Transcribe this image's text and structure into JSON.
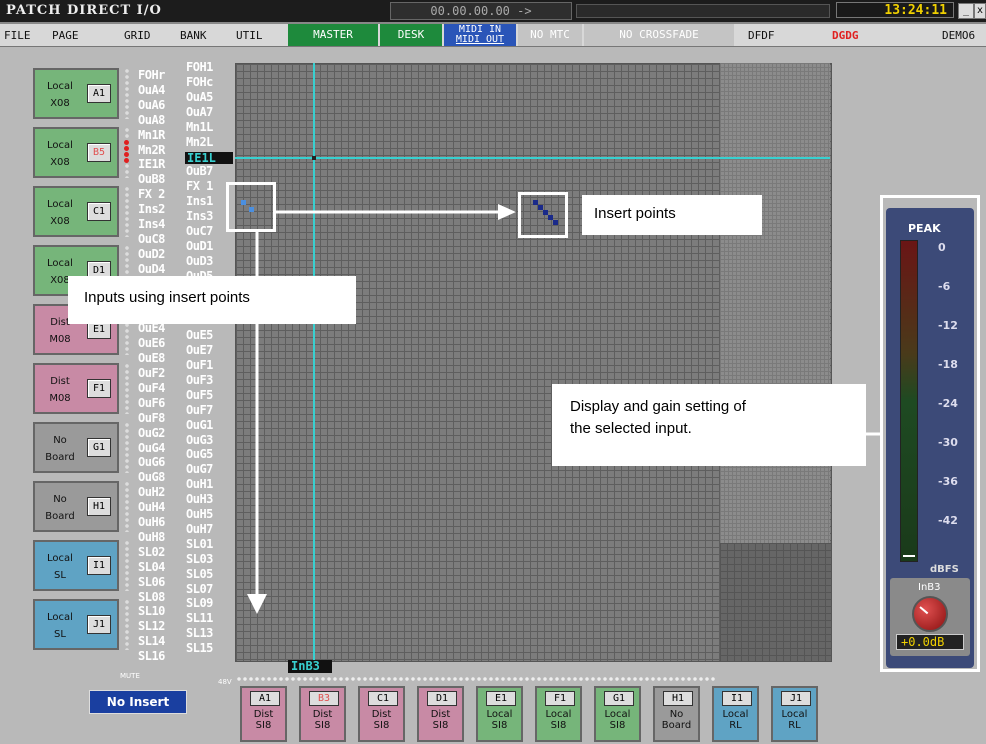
{
  "titlebar": {
    "title": "PATCH DIRECT I/O",
    "timecode": "00.00.00.00  ->",
    "clock": "13:24:11"
  },
  "menu": {
    "items": [
      "FILE",
      "PAGE",
      "GRID",
      "BANK",
      "UTIL"
    ],
    "master": "MASTER",
    "desk": "DESK",
    "midi_in": "MIDI IN",
    "midi_out": "MIDI OUT",
    "no_mtc": "NO MTC",
    "no_crossfade": "NO CROSSFADE",
    "dfdf": "DFDF",
    "dgdg": "DGDG",
    "demo": "DEMO6"
  },
  "left_boards": [
    {
      "line1": "Local",
      "line2": "X08",
      "id": "A1",
      "color": "#76b57a"
    },
    {
      "line1": "Local",
      "line2": "X08",
      "id": "B5",
      "color": "#76b57a",
      "id_color": "#e05050"
    },
    {
      "line1": "Local",
      "line2": "X08",
      "id": "C1",
      "color": "#76b57a"
    },
    {
      "line1": "Local",
      "line2": "X08",
      "id": "D1",
      "color": "#76b57a"
    },
    {
      "line1": "Dist",
      "line2": "M08",
      "id": "E1",
      "color": "#c88aa5"
    },
    {
      "line1": "Dist",
      "line2": "M08",
      "id": "F1",
      "color": "#c88aa5"
    },
    {
      "line1": "No",
      "line2": "Board",
      "id": "G1",
      "color": "#9a9a9a"
    },
    {
      "line1": "No",
      "line2": "Board",
      "id": "H1",
      "color": "#9a9a9a"
    },
    {
      "line1": "Local",
      "line2": "SL",
      "id": "I1",
      "color": "#5fa3c4"
    },
    {
      "line1": "Local",
      "line2": "SL",
      "id": "J1",
      "color": "#5fa3c4"
    }
  ],
  "col_left": [
    "FOHr",
    "OuA4",
    "OuA6",
    "OuA8",
    "Mn1R",
    "Mn2R",
    "IE1R",
    "OuB8",
    "FX 2",
    "Ins2",
    "Ins4",
    "OuC8",
    "OuD2",
    "OuD4",
    "",
    "",
    "",
    "OuE4",
    "OuE6",
    "OuE8",
    "OuF2",
    "OuF4",
    "OuF6",
    "OuF8",
    "OuG2",
    "OuG4",
    "OuG6",
    "OuG8",
    "OuH2",
    "OuH4",
    "OuH6",
    "OuH8",
    "SL02",
    "SL04",
    "SL06",
    "SL08",
    "SL10",
    "SL12",
    "SL14",
    "SL16"
  ],
  "col_right": [
    "FOH1",
    "FOHc",
    "OuA5",
    "OuA7",
    "Mn1L",
    "Mn2L",
    "IE1L",
    "OuB7",
    "FX 1",
    "Ins1",
    "Ins3",
    "OuC7",
    "OuD1",
    "OuD3",
    "OuD5",
    "",
    "",
    "OuE3",
    "OuE5",
    "OuE7",
    "OuF1",
    "OuF3",
    "OuF5",
    "OuF7",
    "OuG1",
    "OuG3",
    "OuG5",
    "OuG7",
    "OuH1",
    "OuH3",
    "OuH5",
    "OuH7",
    "SL01",
    "SL03",
    "SL05",
    "SL07",
    "SL09",
    "SL11",
    "SL13",
    "SL15"
  ],
  "selected_output": "IE1L",
  "selected_input": "InB3",
  "mute_label": "MUTE",
  "v48_label": "48V",
  "no_insert": "No Insert",
  "bottom_boards": [
    {
      "id": "A1",
      "line1": "Dist",
      "line2": "SI8",
      "color": "#c88aa5"
    },
    {
      "id": "B3",
      "line1": "Dist",
      "line2": "SI8",
      "color": "#c88aa5",
      "id_color": "#e05050"
    },
    {
      "id": "C1",
      "line1": "Dist",
      "line2": "SI8",
      "color": "#c88aa5"
    },
    {
      "id": "D1",
      "line1": "Dist",
      "line2": "SI8",
      "color": "#c88aa5"
    },
    {
      "id": "E1",
      "line1": "Local",
      "line2": "SI8",
      "color": "#76b57a"
    },
    {
      "id": "F1",
      "line1": "Local",
      "line2": "SI8",
      "color": "#76b57a"
    },
    {
      "id": "G1",
      "line1": "Local",
      "line2": "SI8",
      "color": "#76b57a"
    },
    {
      "id": "H1",
      "line1": "No",
      "line2": "Board",
      "color": "#9a9a9a"
    },
    {
      "id": "I1",
      "line1": "Local",
      "line2": "RL",
      "color": "#5fa3c4"
    },
    {
      "id": "J1",
      "line1": "Local",
      "line2": "RL",
      "color": "#5fa3c4"
    }
  ],
  "annotations": {
    "insert_points": "Insert points",
    "inputs_using": "Inputs using insert points",
    "display_gain_1": "Display and gain setting of",
    "display_gain_2": "the selected input."
  },
  "meter": {
    "peak": "PEAK",
    "scale": [
      "0",
      "-6",
      "-12",
      "-18",
      "-24",
      "-30",
      "-36",
      "-42"
    ],
    "unit": "dBFS",
    "channel": "InB3",
    "gain": "+0.0dB"
  }
}
